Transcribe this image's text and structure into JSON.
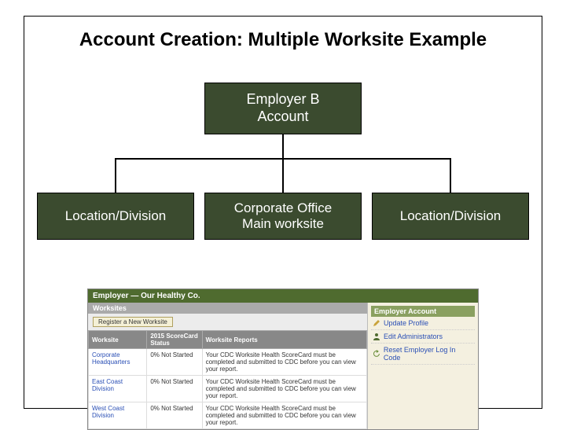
{
  "title": "Account Creation: Multiple Worksite Example",
  "org": {
    "top": "Employer B\nAccount",
    "children": [
      "Location/Division",
      "Corporate Office\nMain worksite",
      "Location/Division"
    ]
  },
  "panel": {
    "header": "Employer — Our Healthy Co.",
    "worksitesHeader": "Worksites",
    "registerBtn": "Register a New Worksite",
    "cols": [
      "Worksite",
      "2015 ScoreCard Status",
      "Worksite Reports"
    ],
    "noteText": "Your CDC Worksite Health ScoreCard must be completed and submitted to CDC before you can view your report.",
    "rows": [
      {
        "name": "Corporate Headquarters",
        "status": "0% Not Started"
      },
      {
        "name": "East Coast Division",
        "status": "0% Not Started"
      },
      {
        "name": "West Coast Division",
        "status": "0% Not Started"
      }
    ],
    "side": {
      "title": "Employer Account",
      "items": [
        "Update Profile",
        "Edit Administrators",
        "Reset Employer Log In Code"
      ]
    }
  }
}
